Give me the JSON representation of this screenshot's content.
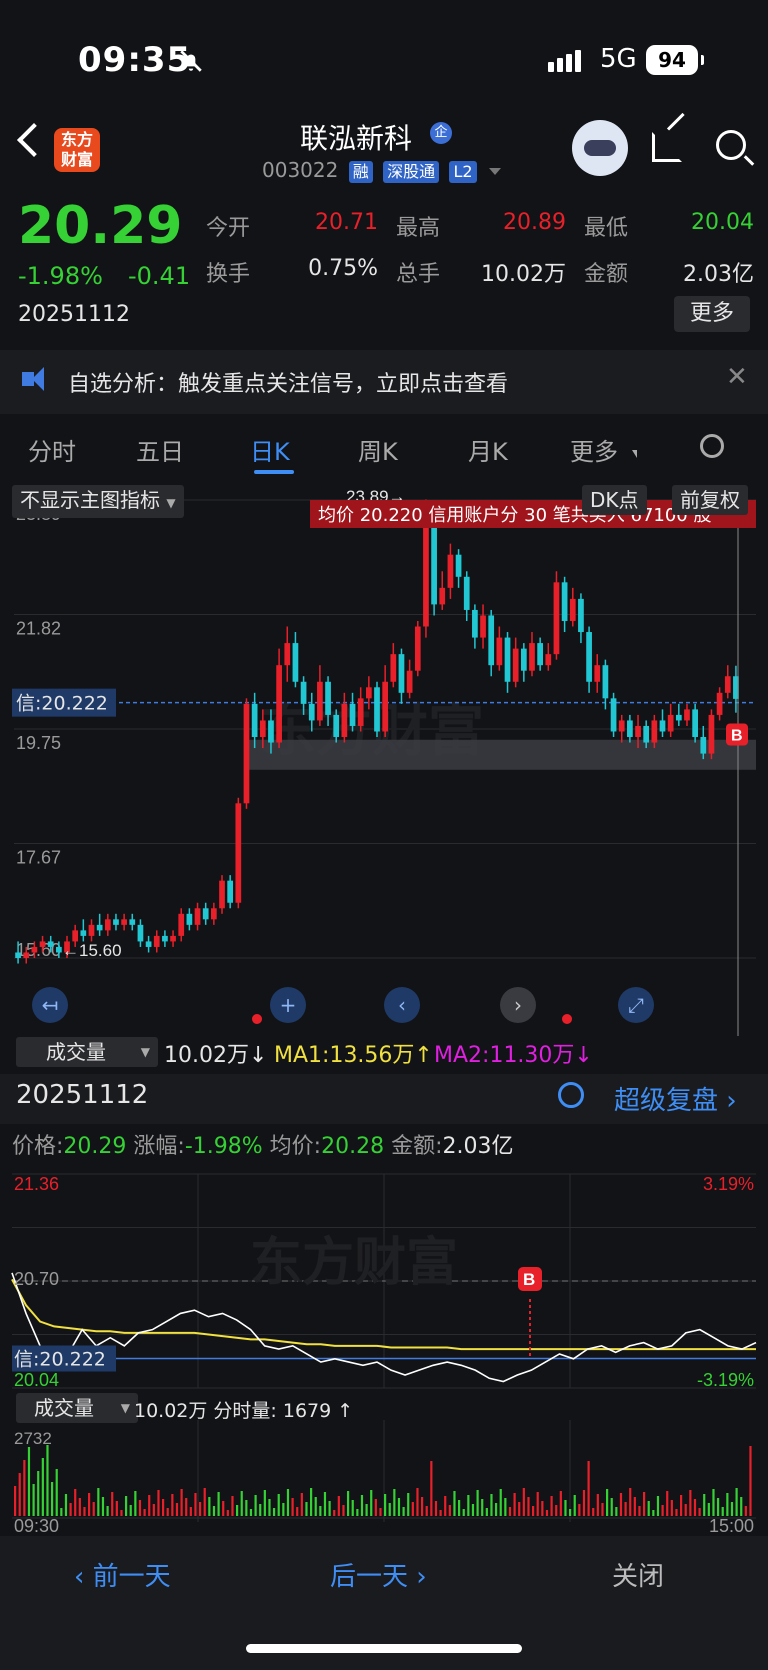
{
  "status_bar": {
    "time": "09:35",
    "network": "5G",
    "battery": "94"
  },
  "header": {
    "app_logo": "东方\n财富",
    "stock_name": "联泓新科",
    "qi_badge": "企",
    "code": "003022",
    "tags": [
      "融",
      "深股通",
      "L2"
    ]
  },
  "quote": {
    "price": "20.29",
    "change_pct": "-1.98%",
    "change_abs": "-0.41",
    "date": "20251112",
    "open_label": "今开",
    "open": "20.71",
    "high_label": "最高",
    "high": "20.89",
    "low_label": "最低",
    "low": "20.04",
    "turnover_label": "换手",
    "turnover": "0.75%",
    "volume_label": "总手",
    "volume": "10.02万",
    "amount_label": "金额",
    "amount": "2.03亿",
    "more_label": "更多"
  },
  "banner": {
    "text": "自选分析：触发重点关注信号，立即点击查看",
    "close": "✕"
  },
  "tabs": [
    "分时",
    "五日",
    "日K",
    "周K",
    "月K",
    "更多"
  ],
  "kchart": {
    "indicator_select": "不显示主图指标",
    "dk_label": "DK点",
    "adjust_label": "前复权",
    "y_labels": [
      "23.89",
      "21.82",
      "19.75",
      "17.67",
      "15.60"
    ],
    "high_mark": "23.89",
    "low_mark": "15.60",
    "credit_label": "信:20.222",
    "notice": "均价 20.220 信用账户分 30 笔共买入 67100 股",
    "watermark": "东方财富",
    "b_marker": "B"
  },
  "volume_bar": {
    "select": "成交量",
    "value": "10.02万↓",
    "ma1": "MA1:13.56万↑",
    "ma2": "MA2:11.30万↓"
  },
  "detail": {
    "date": "20251112",
    "replay": "超级复盘",
    "price_label": "价格:",
    "price": "20.29",
    "pct_label": "涨幅:",
    "pct": "-1.98%",
    "avg_label": "均价:",
    "avg": "20.28",
    "amt_label": "金额:",
    "amt": "2.03亿"
  },
  "intraday": {
    "y_top": "21.36",
    "y_mid": "20.70",
    "y_bot": "20.04",
    "pct_top": "3.19%",
    "pct_bot": "-3.19%",
    "credit_label": "信:20.222",
    "watermark": "东方财富",
    "b_marker": "B",
    "vol_select": "成交量",
    "vol_text": "10.02万 分时量: 1679 ↑",
    "vol_max": "2732",
    "t_start": "09:30",
    "t_end": "15:00"
  },
  "bottom": {
    "prev": "前一天",
    "next": "后一天",
    "close": "关闭"
  },
  "colors": {
    "up": "#e8202a",
    "down": "#35d135",
    "accent": "#3f8ef5",
    "cyan": "#21c8d4",
    "notice_bg": "#a0151c"
  },
  "chart_data": [
    {
      "type": "candlestick",
      "ylim": [
        15.6,
        23.89
      ],
      "y_ticks": [
        "23.89",
        "21.82",
        "19.75",
        "17.67",
        "15.60"
      ],
      "reference_line": 20.222,
      "candles": [
        [
          15.7,
          15.6,
          15.9,
          15.5
        ],
        [
          15.6,
          15.7,
          15.8,
          15.5
        ],
        [
          15.7,
          15.8,
          15.9,
          15.6
        ],
        [
          15.8,
          15.9,
          16.0,
          15.7
        ],
        [
          15.9,
          15.8,
          16.0,
          15.7
        ],
        [
          15.8,
          15.7,
          15.9,
          15.6
        ],
        [
          15.7,
          15.9,
          16.0,
          15.6
        ],
        [
          15.9,
          16.1,
          16.2,
          15.8
        ],
        [
          16.1,
          16.0,
          16.3,
          15.9
        ],
        [
          16.0,
          16.2,
          16.3,
          15.9
        ],
        [
          16.2,
          16.1,
          16.4,
          16.0
        ],
        [
          16.1,
          16.3,
          16.4,
          16.0
        ],
        [
          16.3,
          16.2,
          16.4,
          16.1
        ],
        [
          16.2,
          16.3,
          16.4,
          16.1
        ],
        [
          16.3,
          16.2,
          16.4,
          16.1
        ],
        [
          16.2,
          15.9,
          16.3,
          15.8
        ],
        [
          15.9,
          15.8,
          16.0,
          15.7
        ],
        [
          15.8,
          16.0,
          16.1,
          15.7
        ],
        [
          16.0,
          15.9,
          16.1,
          15.8
        ],
        [
          15.9,
          16.0,
          16.1,
          15.8
        ],
        [
          16.0,
          16.4,
          16.5,
          15.9
        ],
        [
          16.4,
          16.2,
          16.5,
          16.1
        ],
        [
          16.2,
          16.5,
          16.6,
          16.1
        ],
        [
          16.5,
          16.3,
          16.6,
          16.2
        ],
        [
          16.3,
          16.5,
          16.6,
          16.2
        ],
        [
          16.5,
          17.0,
          17.1,
          16.4
        ],
        [
          17.0,
          16.6,
          17.1,
          16.5
        ],
        [
          16.6,
          18.4,
          18.5,
          16.5
        ],
        [
          18.4,
          20.2,
          20.3,
          18.3
        ],
        [
          20.2,
          19.6,
          20.4,
          19.4
        ],
        [
          19.6,
          19.9,
          20.1,
          19.4
        ],
        [
          19.9,
          19.5,
          20.1,
          19.3
        ],
        [
          19.5,
          20.9,
          21.2,
          19.4
        ],
        [
          20.9,
          21.3,
          21.6,
          20.6
        ],
        [
          21.3,
          20.6,
          21.5,
          20.5
        ],
        [
          20.6,
          20.2,
          20.7,
          20.0
        ],
        [
          20.2,
          19.9,
          20.4,
          19.7
        ],
        [
          19.9,
          20.6,
          20.9,
          19.8
        ],
        [
          20.6,
          20.0,
          20.7,
          19.8
        ],
        [
          20.0,
          19.6,
          20.1,
          19.5
        ],
        [
          19.6,
          20.2,
          20.4,
          19.5
        ],
        [
          20.2,
          19.8,
          20.4,
          19.7
        ],
        [
          19.8,
          20.3,
          20.5,
          19.7
        ],
        [
          20.3,
          20.5,
          20.7,
          20.1
        ],
        [
          20.5,
          19.7,
          20.6,
          19.6
        ],
        [
          19.7,
          20.6,
          20.9,
          19.6
        ],
        [
          20.6,
          21.1,
          21.3,
          20.5
        ],
        [
          21.1,
          20.4,
          21.2,
          20.2
        ],
        [
          20.4,
          20.8,
          21.0,
          20.3
        ],
        [
          20.8,
          21.6,
          21.7,
          20.7
        ],
        [
          21.6,
          23.6,
          23.9,
          21.4
        ],
        [
          23.6,
          22.0,
          23.7,
          21.8
        ],
        [
          22.0,
          22.3,
          22.6,
          21.9
        ],
        [
          22.3,
          22.9,
          23.1,
          22.1
        ],
        [
          22.9,
          22.5,
          23.0,
          22.3
        ],
        [
          22.5,
          21.9,
          22.6,
          21.7
        ],
        [
          21.9,
          21.4,
          22.0,
          21.2
        ],
        [
          21.4,
          21.8,
          22.0,
          21.2
        ],
        [
          21.8,
          20.9,
          21.9,
          20.7
        ],
        [
          20.9,
          21.4,
          21.6,
          20.8
        ],
        [
          21.4,
          20.6,
          21.5,
          20.4
        ],
        [
          20.6,
          21.2,
          21.4,
          20.5
        ],
        [
          21.2,
          20.8,
          21.3,
          20.6
        ],
        [
          20.8,
          21.3,
          21.5,
          20.7
        ],
        [
          21.3,
          20.9,
          21.4,
          20.8
        ],
        [
          20.9,
          21.1,
          21.3,
          20.8
        ],
        [
          21.1,
          22.4,
          22.6,
          21.0
        ],
        [
          22.4,
          21.7,
          22.5,
          21.5
        ],
        [
          21.7,
          22.1,
          22.3,
          21.6
        ],
        [
          22.1,
          21.5,
          22.2,
          21.3
        ],
        [
          21.5,
          20.6,
          21.6,
          20.4
        ],
        [
          20.6,
          20.9,
          21.1,
          20.4
        ],
        [
          20.9,
          20.3,
          21.0,
          20.1
        ],
        [
          20.3,
          19.7,
          20.4,
          19.6
        ],
        [
          19.7,
          19.9,
          20.0,
          19.5
        ],
        [
          19.9,
          19.6,
          20.0,
          19.5
        ],
        [
          19.6,
          19.8,
          20.0,
          19.4
        ],
        [
          19.8,
          19.5,
          19.9,
          19.4
        ],
        [
          19.5,
          19.9,
          20.0,
          19.4
        ],
        [
          19.9,
          19.7,
          20.1,
          19.6
        ],
        [
          19.7,
          20.0,
          20.2,
          19.6
        ],
        [
          20.0,
          19.9,
          20.2,
          19.8
        ],
        [
          19.9,
          20.1,
          20.2,
          19.8
        ],
        [
          20.1,
          19.6,
          20.2,
          19.5
        ],
        [
          19.6,
          19.3,
          19.8,
          19.2
        ],
        [
          19.3,
          20.0,
          20.1,
          19.2
        ],
        [
          20.0,
          20.4,
          20.5,
          19.9
        ],
        [
          20.4,
          20.7,
          20.9,
          20.3
        ],
        [
          20.7,
          20.29,
          20.89,
          20.04
        ]
      ]
    },
    {
      "type": "line",
      "title": "分时",
      "ylim": [
        20.04,
        21.36
      ],
      "reference_line": 20.7,
      "credit_line": 20.222,
      "price": [
        20.75,
        20.5,
        20.3,
        20.15,
        20.25,
        20.4,
        20.3,
        20.35,
        20.3,
        20.38,
        20.4,
        20.45,
        20.5,
        20.52,
        20.48,
        20.5,
        20.46,
        20.4,
        20.3,
        20.28,
        20.3,
        20.25,
        20.2,
        20.22,
        20.2,
        20.18,
        20.2,
        20.15,
        20.12,
        20.15,
        20.18,
        20.2,
        20.18,
        20.15,
        20.1,
        20.08,
        20.12,
        20.15,
        20.2,
        20.25,
        20.22,
        20.28,
        20.3,
        20.26,
        20.3,
        20.32,
        20.28,
        20.3,
        20.38,
        20.4,
        20.35,
        20.3,
        20.28,
        20.32
      ],
      "avg": [
        20.71,
        20.55,
        20.45,
        20.42,
        20.41,
        20.4,
        20.39,
        20.39,
        20.38,
        20.38,
        20.38,
        20.38,
        20.38,
        20.38,
        20.37,
        20.36,
        20.35,
        20.34,
        20.34,
        20.33,
        20.32,
        20.31,
        20.31,
        20.3,
        20.3,
        20.3,
        20.3,
        20.29,
        20.29,
        20.29,
        20.29,
        20.29,
        20.28,
        20.28,
        20.28,
        20.28,
        20.28,
        20.28,
        20.28,
        20.28,
        20.28,
        20.28,
        20.28,
        20.28,
        20.28,
        20.28,
        20.28,
        20.28,
        20.28,
        20.28,
        20.28,
        20.28,
        20.28,
        20.28
      ]
    }
  ]
}
